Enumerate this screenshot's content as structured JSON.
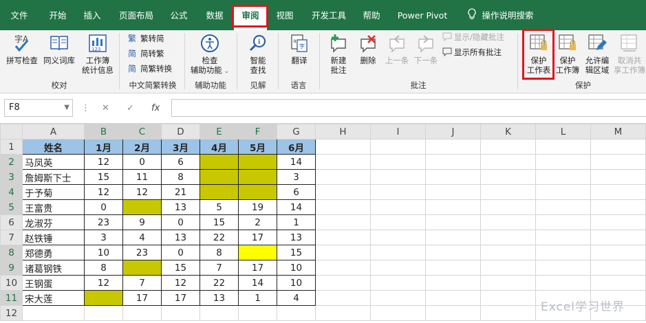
{
  "tabs": [
    "文件",
    "开始",
    "插入",
    "页面布局",
    "公式",
    "数据",
    "审阅",
    "视图",
    "开发工具",
    "帮助",
    "Power Pivot"
  ],
  "tell_me": "操作说明搜索",
  "ribbon": {
    "spelling": "拼写检查",
    "thesaurus": "同义词库",
    "workbook_stats_1": "工作簿",
    "workbook_stats_2": "统计信息",
    "group_proofing": "校对",
    "trad_to_simp": "繁转简",
    "simp_to_trad": "简转繁",
    "conversion": "简繁转换",
    "group_chinese": "中文简繁转换",
    "check_access_1": "检查",
    "check_access_2": "辅助功能",
    "group_access": "辅助功能",
    "smart_lookup_1": "智能",
    "smart_lookup_2": "查找",
    "group_insights": "见解",
    "translate": "翻译",
    "group_language": "语言",
    "new_comment_1": "新建",
    "new_comment_2": "批注",
    "delete": "删除",
    "previous": "上一条",
    "next": "下一条",
    "show_hide_comment": "显示/隐藏批注",
    "show_all_comments": "显示所有批注",
    "group_comments": "批注",
    "protect_sheet_1": "保护",
    "protect_sheet_2": "工作表",
    "protect_workbook_1": "保护",
    "protect_workbook_2": "工作簿",
    "allow_edit_1": "允许编",
    "allow_edit_2": "辑区域",
    "unshare_1": "取消共",
    "unshare_2": "享工作簿",
    "group_protect": "保护"
  },
  "formula_bar": {
    "name_box": "F8",
    "fx": "fx",
    "value": ""
  },
  "columns": [
    "A",
    "B",
    "C",
    "D",
    "E",
    "F",
    "G",
    "H",
    "I",
    "J",
    "K",
    "L",
    "M"
  ],
  "sheet": {
    "headers": [
      "姓名",
      "1月",
      "2月",
      "3月",
      "4月",
      "5月",
      "6月"
    ],
    "rows": [
      [
        "马凤英",
        "12",
        "0",
        "6",
        "",
        "",
        "14"
      ],
      [
        "詹姆斯下士",
        "15",
        "11",
        "8",
        "",
        "",
        "3"
      ],
      [
        "于予菊",
        "12",
        "12",
        "21",
        "",
        "",
        "6"
      ],
      [
        "王富贵",
        "0",
        "",
        "13",
        "5",
        "19",
        "14"
      ],
      [
        "龙淑芬",
        "23",
        "9",
        "0",
        "15",
        "2",
        "1"
      ],
      [
        "赵铁锤",
        "3",
        "4",
        "13",
        "22",
        "17",
        "13"
      ],
      [
        "郑德勇",
        "10",
        "23",
        "0",
        "8",
        "",
        "15"
      ],
      [
        "诸葛钢铁",
        "8",
        "",
        "15",
        "7",
        "17",
        "10"
      ],
      [
        "王钢蛋",
        "12",
        "7",
        "12",
        "22",
        "14",
        "10"
      ],
      [
        "宋大莲",
        "",
        "17",
        "17",
        "13",
        "1",
        "4"
      ]
    ]
  },
  "watermark": "Excel学习世界",
  "colors": {
    "ribbon_green": "#217346",
    "highlight_red": "#e1141e",
    "header_blue": "#9dc3e6",
    "olive": "#c8c800",
    "yellow": "#ffff00"
  }
}
